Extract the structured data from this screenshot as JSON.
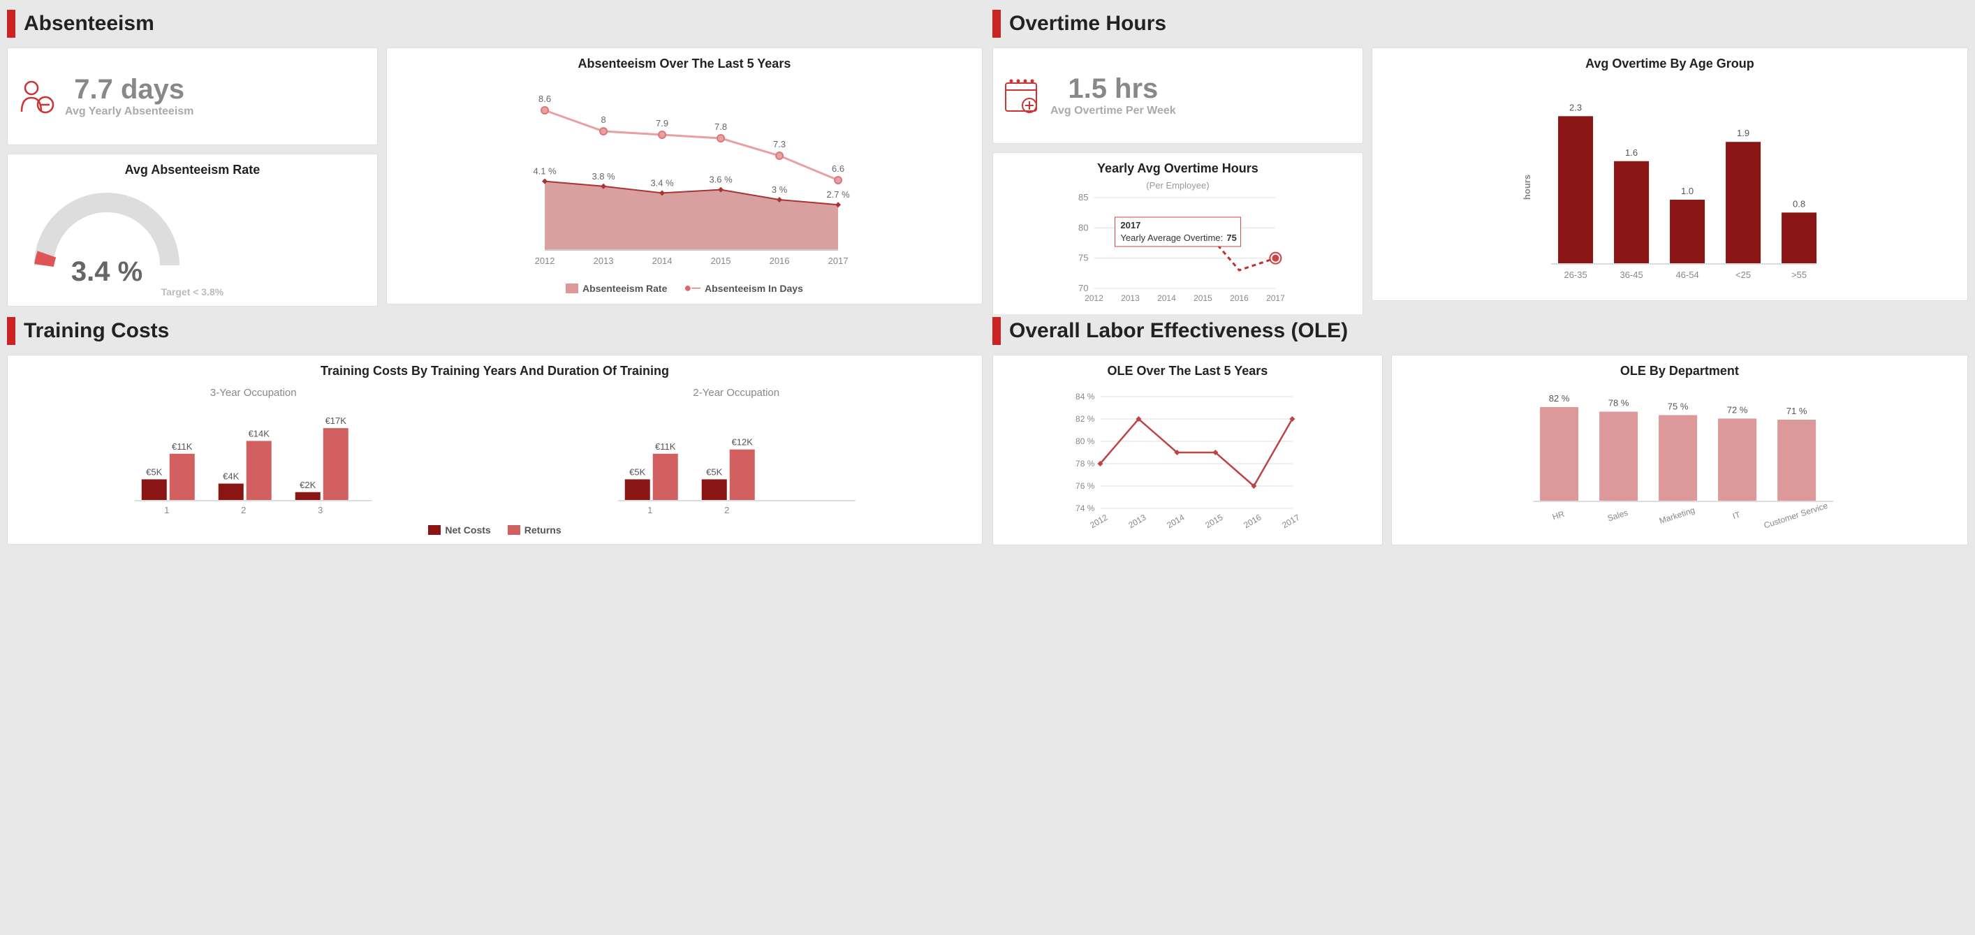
{
  "absenteeism": {
    "title": "Absenteeism",
    "kpi_value": "7.7 days",
    "kpi_label": "Avg Yearly Absenteeism",
    "gauge_title": "Avg Absenteeism Rate",
    "gauge_value": "3.4 %",
    "gauge_target": "Target < 3.8%",
    "chart_title": "Absenteeism Over The Last 5 Years",
    "legend_rate": "Absenteeism Rate",
    "legend_days": "Absenteeism In Days"
  },
  "overtime": {
    "title": "Overtime Hours",
    "kpi_value": "1.5 hrs",
    "kpi_label": "Avg Overtime Per Week",
    "yearly_title": "Yearly Avg Overtime Hours",
    "yearly_sub": "(Per Employee)",
    "tooltip_year": "2017",
    "tooltip_line": "Yearly Average Overtime: ",
    "tooltip_val": "75",
    "bar_title": "Avg Overtime By Age Group",
    "y_label": "hours"
  },
  "training": {
    "title": "Training Costs",
    "chart_title": "Training Costs By Training Years And Duration Of Training",
    "sub3": "3-Year Occupation",
    "sub2": "2-Year Occupation",
    "legend_net": "Net Costs",
    "legend_ret": "Returns"
  },
  "ole": {
    "title": "Overall Labor Effectiveness (OLE)",
    "line_title": "OLE Over The Last 5 Years",
    "bar_title": "OLE By Department"
  },
  "chart_data": [
    {
      "type": "line_area",
      "name": "absenteeism_5yr",
      "x": [
        "2012",
        "2013",
        "2014",
        "2015",
        "2016",
        "2017"
      ],
      "series": [
        {
          "name": "Absenteeism In Days",
          "values": [
            8.6,
            8.0,
            7.9,
            7.8,
            7.3,
            6.6
          ]
        },
        {
          "name": "Absenteeism Rate",
          "values": [
            4.1,
            3.8,
            3.4,
            3.6,
            3.0,
            2.7
          ],
          "unit": "%"
        }
      ]
    },
    {
      "type": "gauge",
      "name": "absenteeism_rate",
      "value": 3.4,
      "target": 3.8,
      "unit": "%"
    },
    {
      "type": "line",
      "name": "yearly_overtime",
      "x": [
        "2012",
        "2013",
        "2014",
        "2015",
        "2016",
        "2017"
      ],
      "values": [
        null,
        null,
        null,
        80,
        73,
        75
      ],
      "ylim": [
        70,
        85
      ],
      "highlight": {
        "x": "2017",
        "value": 75
      }
    },
    {
      "type": "bar",
      "name": "overtime_by_age",
      "categories": [
        "26-35",
        "36-45",
        "46-54",
        "<25",
        ">55"
      ],
      "values": [
        2.3,
        1.6,
        1.0,
        1.9,
        0.8
      ],
      "ylabel": "hours"
    },
    {
      "type": "grouped_bar",
      "name": "training_3yr",
      "categories": [
        "1",
        "2",
        "3"
      ],
      "series": [
        {
          "name": "Net Costs",
          "values": [
            5,
            4,
            2
          ],
          "unit": "€K"
        },
        {
          "name": "Returns",
          "values": [
            11,
            14,
            17
          ],
          "unit": "€K"
        }
      ]
    },
    {
      "type": "grouped_bar",
      "name": "training_2yr",
      "categories": [
        "1",
        "2"
      ],
      "series": [
        {
          "name": "Net Costs",
          "values": [
            5,
            5
          ],
          "unit": "€K"
        },
        {
          "name": "Returns",
          "values": [
            11,
            12
          ],
          "unit": "€K"
        }
      ]
    },
    {
      "type": "line",
      "name": "ole_5yr",
      "x": [
        "2012",
        "2013",
        "2014",
        "2015",
        "2016",
        "2017"
      ],
      "values": [
        78,
        82,
        79,
        79,
        76,
        82
      ],
      "ylim": [
        74,
        84
      ],
      "unit": "%"
    },
    {
      "type": "bar",
      "name": "ole_dept",
      "categories": [
        "HR",
        "Sales",
        "Marketing",
        "IT",
        "Customer Service"
      ],
      "values": [
        82,
        78,
        75,
        72,
        71
      ],
      "unit": "%"
    }
  ]
}
